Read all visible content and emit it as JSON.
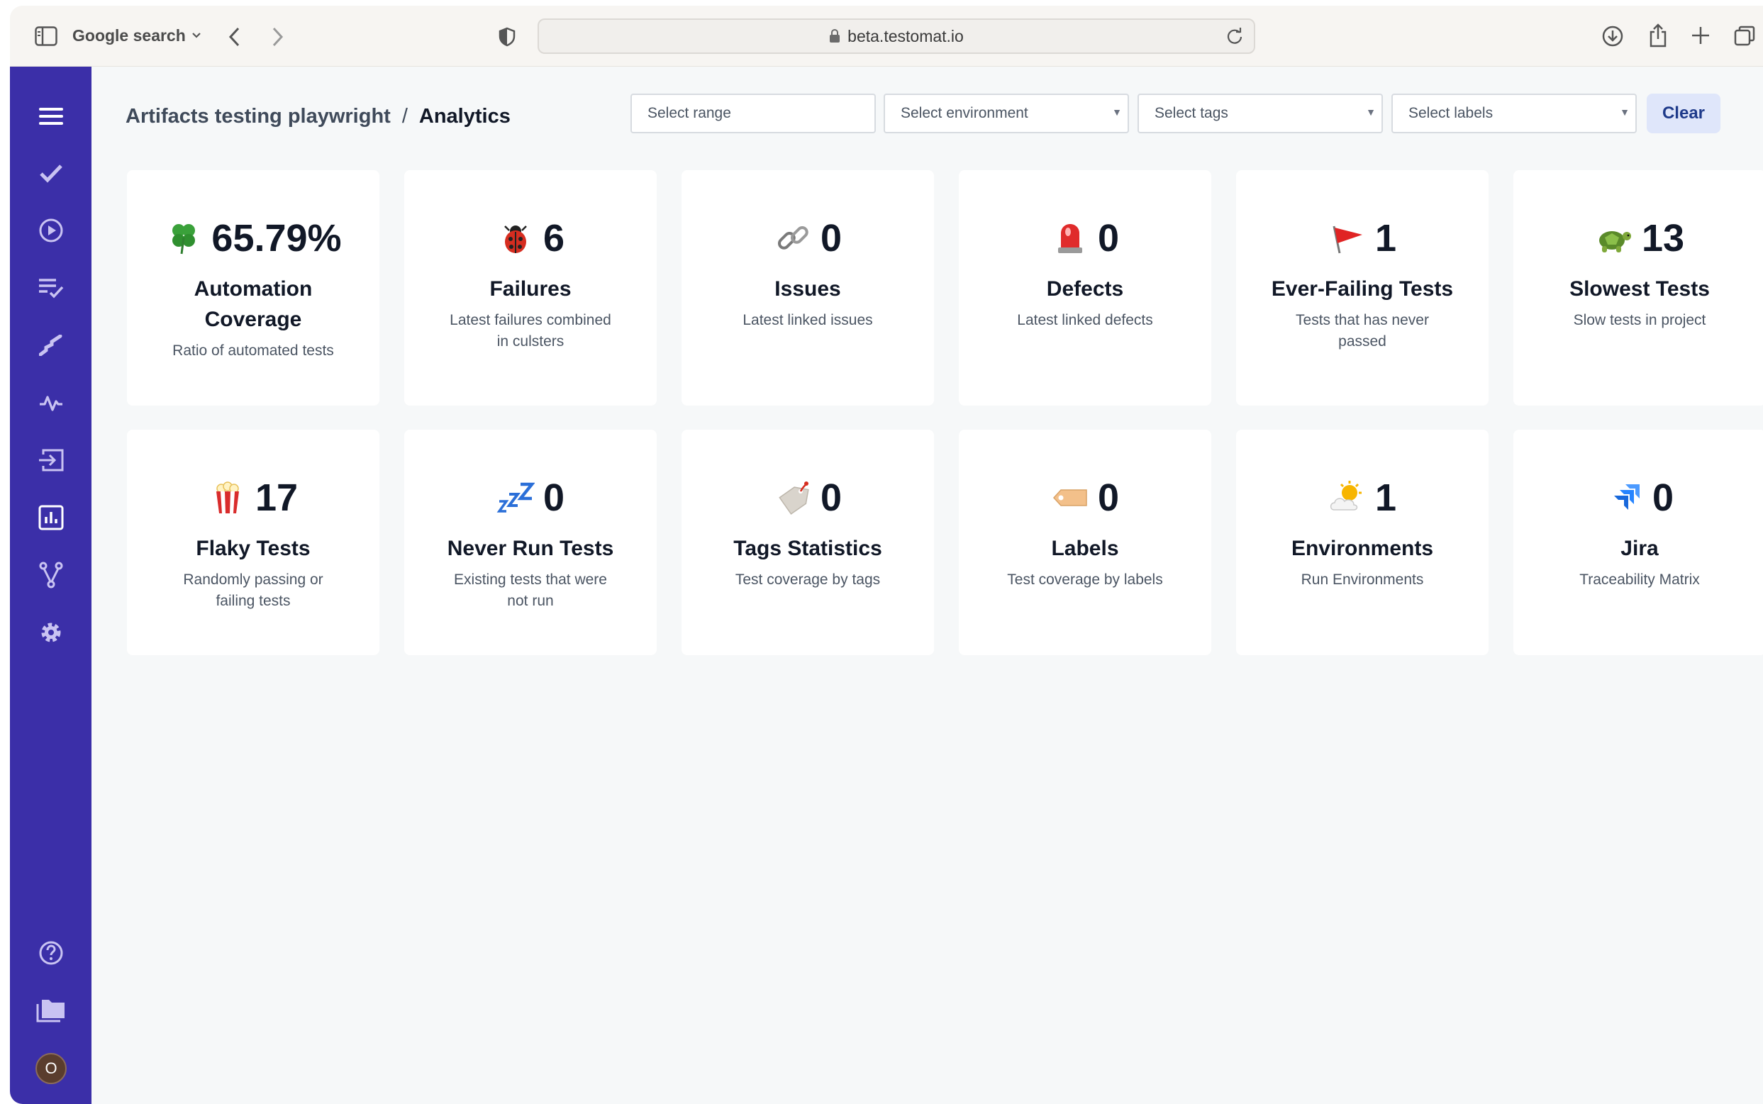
{
  "browser": {
    "search_label": "Google search",
    "url": "beta.testomat.io"
  },
  "header": {
    "project": "Artifacts testing playwright",
    "separator": "/",
    "page": "Analytics"
  },
  "filters": {
    "range_placeholder": "Select range",
    "environment_placeholder": "Select environment",
    "tags_placeholder": "Select tags",
    "labels_placeholder": "Select labels",
    "clear_label": "Clear"
  },
  "user": {
    "avatar_initial": "O"
  },
  "cards": [
    {
      "emoji": "four-leaf-clover",
      "value": "65.79%",
      "title": "Automation Coverage",
      "desc": "Ratio of automated tests"
    },
    {
      "emoji": "lady-beetle",
      "value": "6",
      "title": "Failures",
      "desc": "Latest failures combined in culsters"
    },
    {
      "emoji": "link",
      "value": "0",
      "title": "Issues",
      "desc": "Latest linked issues"
    },
    {
      "emoji": "police-light",
      "value": "0",
      "title": "Defects",
      "desc": "Latest linked defects"
    },
    {
      "emoji": "red-flag",
      "value": "1",
      "title": "Ever-Failing Tests",
      "desc": "Tests that has never passed"
    },
    {
      "emoji": "turtle",
      "value": "13",
      "title": "Slowest Tests",
      "desc": "Slow tests in project"
    },
    {
      "emoji": "popcorn",
      "value": "17",
      "title": "Flaky Tests",
      "desc": "Randomly passing or failing tests"
    },
    {
      "emoji": "zzz",
      "value": "0",
      "title": "Never Run Tests",
      "desc": "Existing tests that were not run"
    },
    {
      "emoji": "tag",
      "value": "0",
      "title": "Tags Statistics",
      "desc": "Test coverage by tags"
    },
    {
      "emoji": "label",
      "value": "0",
      "title": "Labels",
      "desc": "Test coverage by labels"
    },
    {
      "emoji": "sun-behind-cloud",
      "value": "1",
      "title": "Environments",
      "desc": "Run Environments"
    },
    {
      "emoji": "jira",
      "value": "0",
      "title": "Jira",
      "desc": "Traceability Matrix"
    }
  ],
  "colors": {
    "sidebar": "#3b2fa8",
    "clear_button_bg": "#dfe6fa",
    "clear_button_text": "#1e3a8a"
  }
}
